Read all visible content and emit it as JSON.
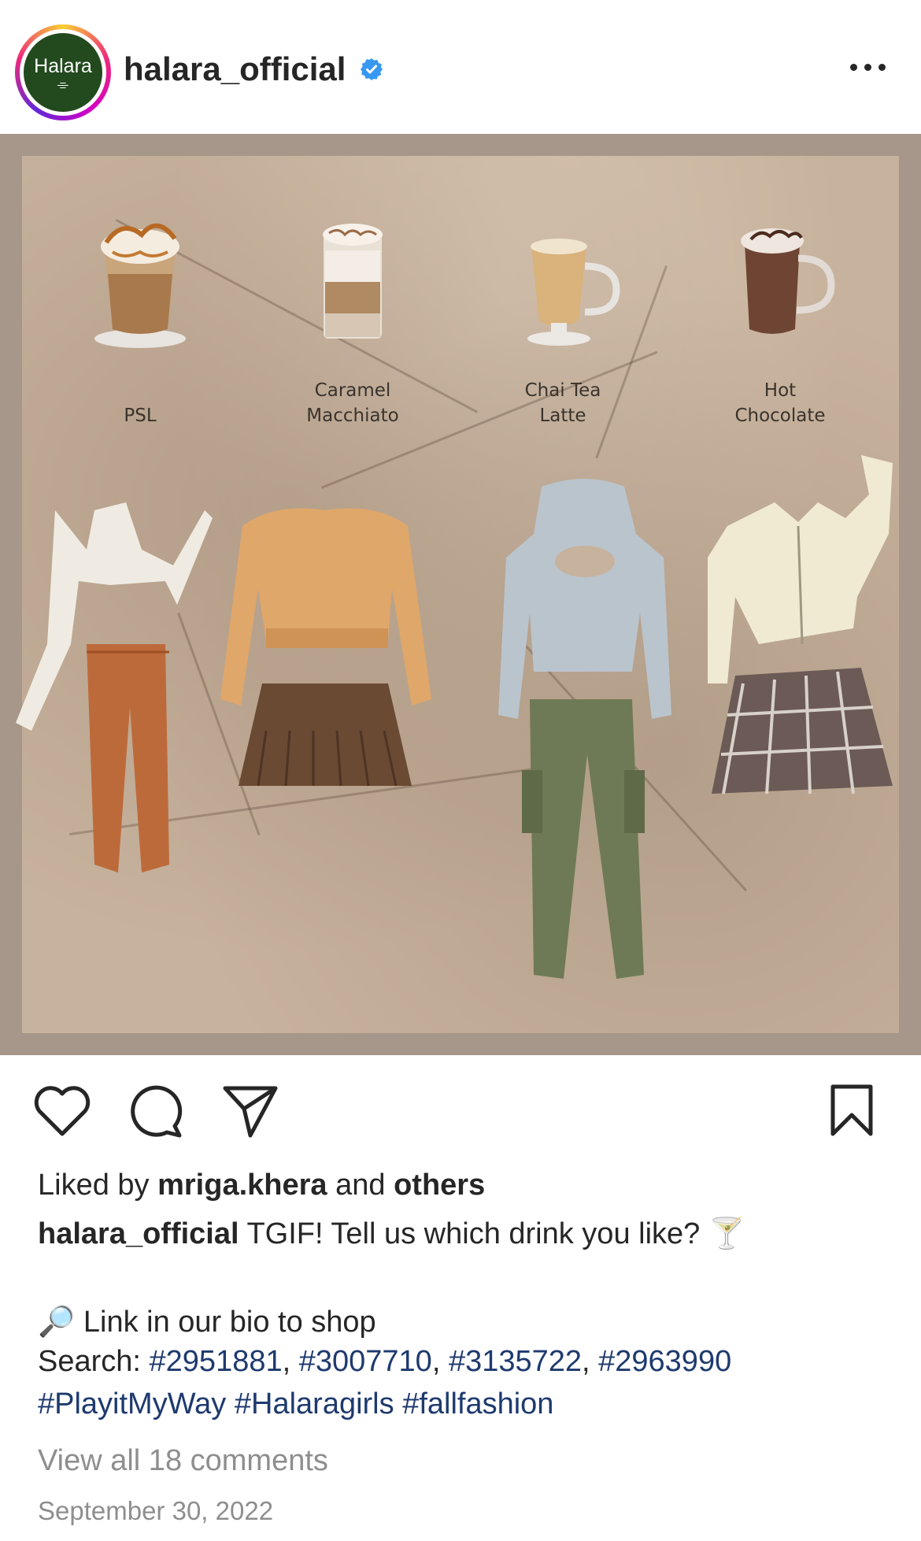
{
  "header": {
    "avatar_text": "Halara",
    "username": "halara_official",
    "verified": true
  },
  "post": {
    "drinks": [
      {
        "name": "PSL",
        "line1": "",
        "line2": "PSL"
      },
      {
        "name": "Caramel Macchiato",
        "line1": "Caramel",
        "line2": "Macchiato"
      },
      {
        "name": "Chai Tea Latte",
        "line1": "Chai Tea",
        "line2": "Latte"
      },
      {
        "name": "Hot Chocolate",
        "line1": "Hot",
        "line2": "Chocolate"
      }
    ]
  },
  "actions": {
    "like_icon": "heart-icon",
    "comment_icon": "comment-icon",
    "share_icon": "paper-plane-icon",
    "save_icon": "bookmark-icon"
  },
  "likes": {
    "prefix": "Liked by",
    "user": "mriga.khera",
    "middle": "and",
    "others": "others"
  },
  "caption": {
    "username": "halara_official",
    "text": "TGIF! Tell us which drink you like?",
    "emoji": "🍸",
    "bio_emoji": "🔎",
    "bio_text": "Link in our bio to shop",
    "search_label": "Search:",
    "search_tags": [
      "#2951881",
      "#3007710",
      "#3135722",
      "#2963990"
    ],
    "hashtags": [
      "#PlayitMyWay",
      "#Halaragirls",
      "#fallfashion"
    ]
  },
  "comments": {
    "view_all": "View all 18 comments"
  },
  "date": "September 30, 2022",
  "colors": {
    "link": "#1e3a6e",
    "muted": "#8e8e8e",
    "verified": "#3897f0",
    "avatar_bg": "#234a1e"
  }
}
